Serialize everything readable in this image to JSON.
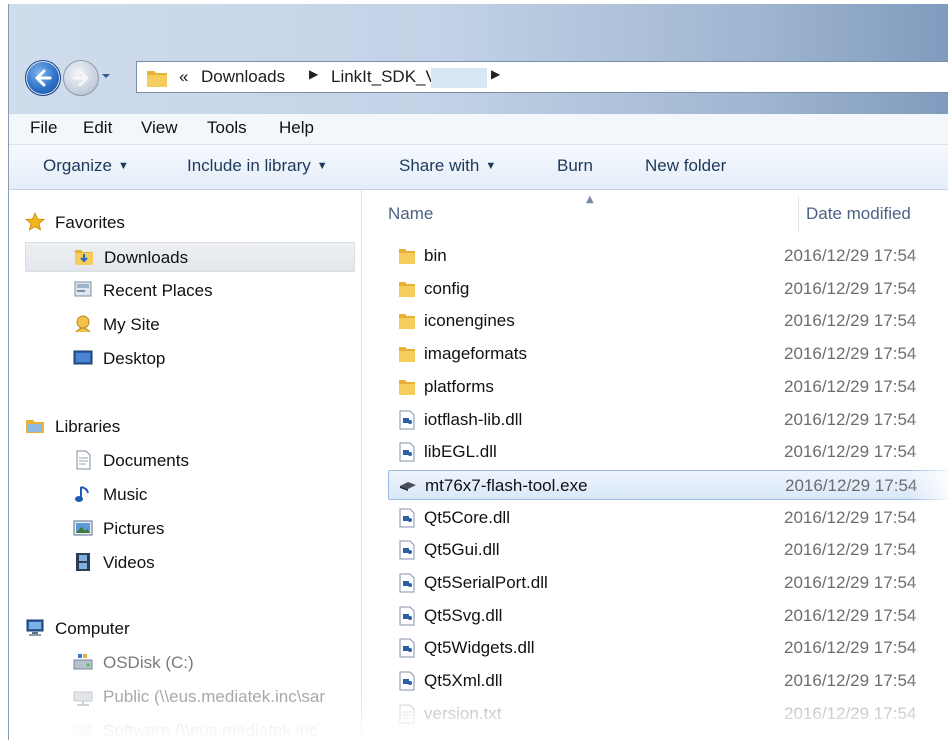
{
  "address": {
    "overflow": "«",
    "crumbs": [
      "Downloads",
      "LinkIt_SDK_V"
    ]
  },
  "menubar": [
    "File",
    "Edit",
    "View",
    "Tools",
    "Help"
  ],
  "toolbar": {
    "organize": "Organize",
    "include": "Include in library",
    "share": "Share with",
    "burn": "Burn",
    "new_folder": "New folder"
  },
  "nav": {
    "favorites": "Favorites",
    "downloads": "Downloads",
    "recent": "Recent Places",
    "mysite": "My Site",
    "desktop": "Desktop",
    "libraries": "Libraries",
    "documents": "Documents",
    "music": "Music",
    "pictures": "Pictures",
    "videos": "Videos",
    "computer": "Computer",
    "osdisk": "OSDisk (C:)",
    "public": "Public (\\\\eus.mediatek.inc\\sar",
    "software": "Software (\\\\eus.mediatek.inc"
  },
  "columns": {
    "name": "Name",
    "date": "Date modified"
  },
  "files": [
    {
      "name": "bin",
      "date": "2016/12/29 17:54",
      "type": "folder"
    },
    {
      "name": "config",
      "date": "2016/12/29 17:54",
      "type": "folder"
    },
    {
      "name": "iconengines",
      "date": "2016/12/29 17:54",
      "type": "folder"
    },
    {
      "name": "imageformats",
      "date": "2016/12/29 17:54",
      "type": "folder"
    },
    {
      "name": "platforms",
      "date": "2016/12/29 17:54",
      "type": "folder"
    },
    {
      "name": "iotflash-lib.dll",
      "date": "2016/12/29 17:54",
      "type": "dll"
    },
    {
      "name": "libEGL.dll",
      "date": "2016/12/29 17:54",
      "type": "dll"
    },
    {
      "name": "mt76x7-flash-tool.exe",
      "date": "2016/12/29 17:54",
      "type": "exe",
      "selected": true
    },
    {
      "name": "Qt5Core.dll",
      "date": "2016/12/29 17:54",
      "type": "dll"
    },
    {
      "name": "Qt5Gui.dll",
      "date": "2016/12/29 17:54",
      "type": "dll"
    },
    {
      "name": "Qt5SerialPort.dll",
      "date": "2016/12/29 17:54",
      "type": "dll"
    },
    {
      "name": "Qt5Svg.dll",
      "date": "2016/12/29 17:54",
      "type": "dll"
    },
    {
      "name": "Qt5Widgets.dll",
      "date": "2016/12/29 17:54",
      "type": "dll"
    },
    {
      "name": "Qt5Xml.dll",
      "date": "2016/12/29 17:54",
      "type": "dll"
    },
    {
      "name": "version.txt",
      "date": "2016/12/29 17:54",
      "type": "txt"
    }
  ],
  "colors": {
    "folder": "#e8b23a",
    "selection": "#d9e8fa",
    "toolbar_text": "#1e395b"
  }
}
